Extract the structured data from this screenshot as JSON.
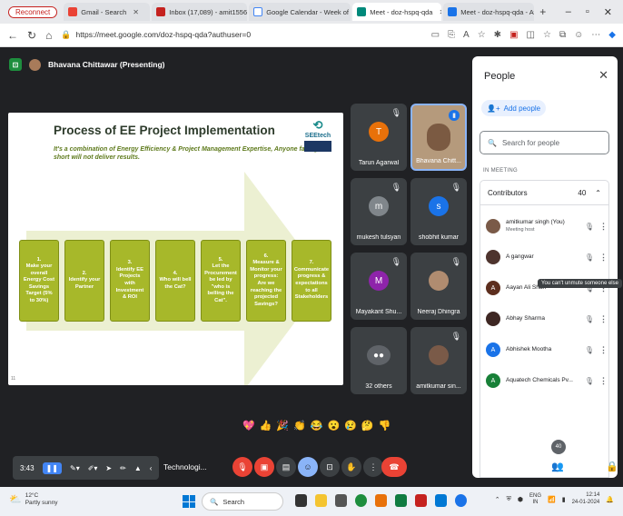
{
  "browser": {
    "tabs": [
      {
        "label": "Reconnect"
      },
      {
        "label": "Gmail - Search"
      },
      {
        "label": "Inbox (17,089) - amit15567@..."
      },
      {
        "label": "Google Calendar - Week of 2..."
      },
      {
        "label": "Meet - doz-hspq-qda"
      },
      {
        "label": "Meet - doz-hspq-qda - Aves..."
      }
    ],
    "url": "https://meet.google.com/doz-hspq-qda?authuser=0"
  },
  "meet": {
    "presenter_label": "Bhavana Chittawar (Presenting)",
    "slide": {
      "title": "Process of EE Project Implementation",
      "subtitle": "It's a combination of Energy Efficiency & Project Management Expertise, Anyone falling short will not deliver results.",
      "logo_name": "SEEtech",
      "page_number": "11",
      "steps": [
        "1.\nMake your overall Energy Cost Savings Target (5% to 30%)",
        "2.\nIdentify your Partner",
        "3.\nIdentify EE Projects with Investment & ROI",
        "4.\nWho will bell the Cat?",
        "5.\nLet the Procurement be led by \"who is belling the Cat\".",
        "6.\nMeasure & Monitor your progress: Are we reaching the projected Savings?",
        "7.\nCommunicate progress & expectations to all Stakeholders"
      ]
    },
    "tiles": [
      {
        "name": "Tarun Agarwal",
        "initial": "T",
        "color": "#e8710a"
      },
      {
        "name": "Bhavana Chitt...",
        "initial": "",
        "color": "#c9a882"
      },
      {
        "name": "mukesh tulsyan",
        "initial": "m",
        "color": "#80868b"
      },
      {
        "name": "shobhit kumar",
        "initial": "s",
        "color": "#1a73e8"
      },
      {
        "name": "Mayakant Shu...",
        "initial": "M",
        "color": "#8e24aa"
      },
      {
        "name": "Neeraj Dhingra",
        "initial": "",
        "color": "#b08c70"
      },
      {
        "name": "32 others",
        "initial": "",
        "color": "#5f6368"
      },
      {
        "name": "amitkumar sin...",
        "initial": "",
        "color": "#7a5a48"
      }
    ],
    "reactions": [
      "💖",
      "👍",
      "🎉",
      "👏",
      "😂",
      "😮",
      "😢",
      "🤔",
      "👎"
    ],
    "controls": {
      "time": "3:43",
      "tech_label": "Technologi...",
      "participants_count": "40"
    }
  },
  "people": {
    "title": "People",
    "add_people": "Add people",
    "search_placeholder": "Search for people",
    "in_meeting": "IN MEETING",
    "contributors_label": "Contributors",
    "contributors_count": "40",
    "list": [
      {
        "name": "amitkumar singh (You)",
        "sub": "Meeting host",
        "initial": "",
        "color": "#7a5a48"
      },
      {
        "name": "A gangwar",
        "sub": "",
        "initial": "",
        "color": "#4e342e"
      },
      {
        "name": "Aayan Ali Shan",
        "sub": "",
        "initial": "A",
        "color": "#5d2e1e"
      },
      {
        "name": "Abhay Sharma",
        "sub": "",
        "initial": "",
        "color": "#3e2723"
      },
      {
        "name": "Abhishek Mootha",
        "sub": "",
        "initial": "A",
        "color": "#1a73e8"
      },
      {
        "name": "Aquatech Chemicals Pv...",
        "sub": "",
        "initial": "A",
        "color": "#188038"
      }
    ],
    "tooltip": "You can't unmute someone else"
  },
  "taskbar": {
    "temp": "12°C",
    "weather": "Partly sunny",
    "search": "Search",
    "lang_top": "ENG",
    "lang_bottom": "IN",
    "time": "12:14",
    "date": "24-01-2024"
  }
}
